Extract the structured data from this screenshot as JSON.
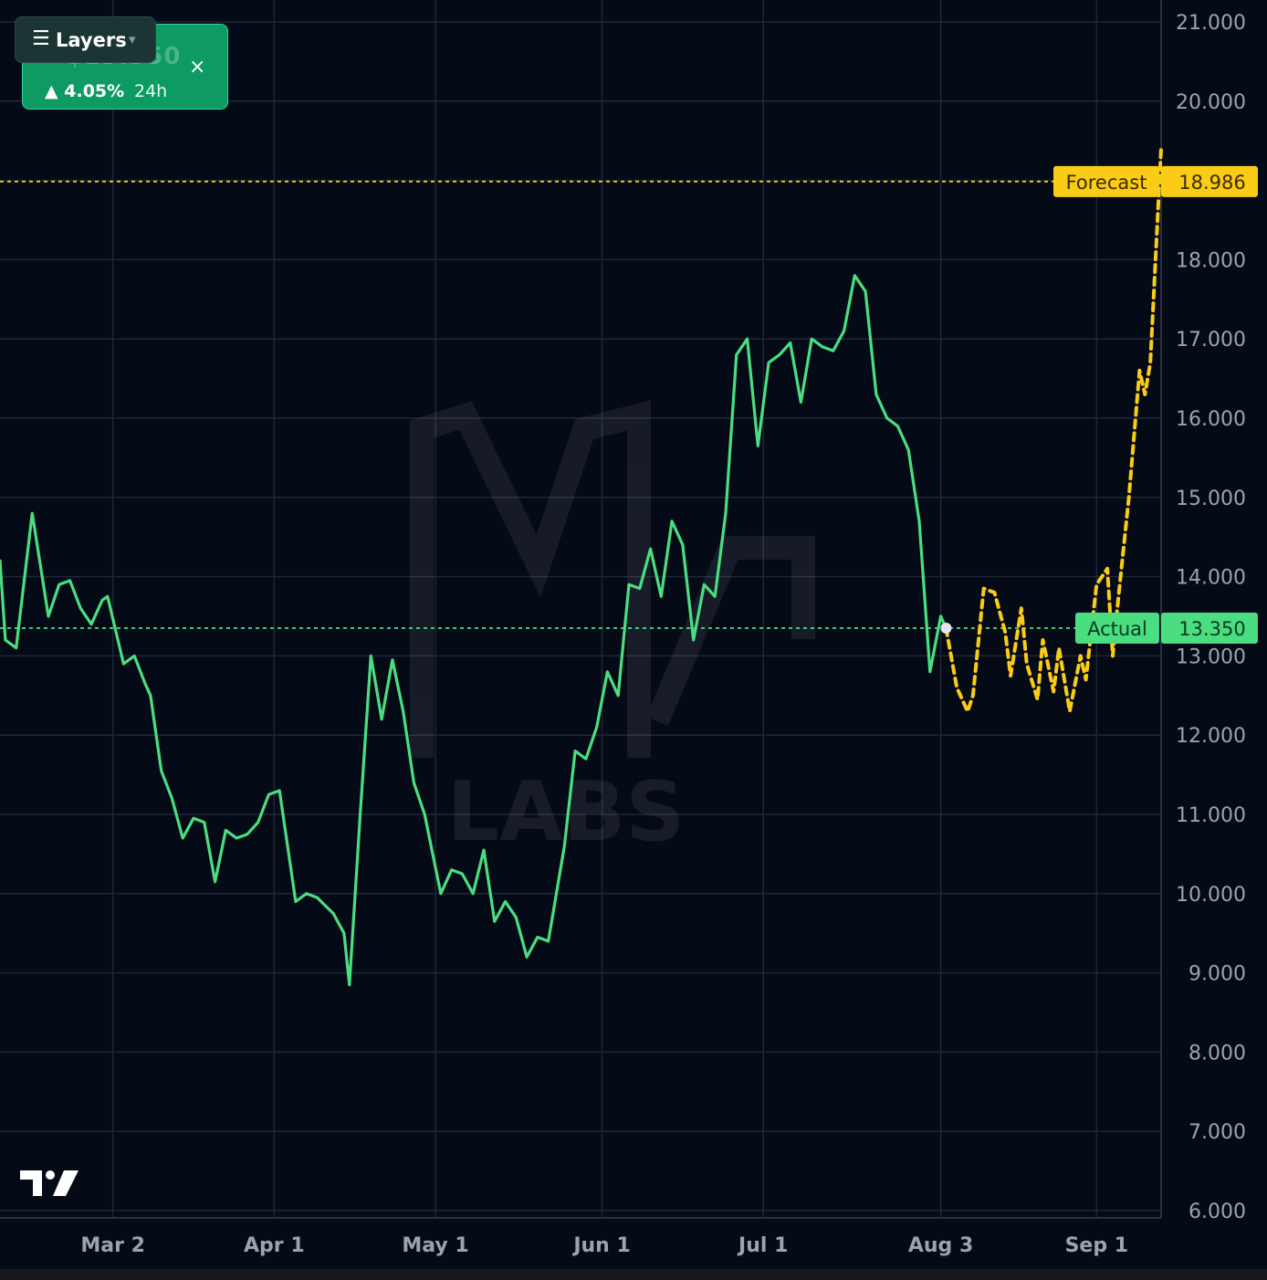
{
  "price_card": {
    "price": "$13.350",
    "change_arrow": "▲",
    "change": "4.05%",
    "period": "24h",
    "close_icon": "×"
  },
  "layers": {
    "menu_icon": "☰",
    "label": "Layers",
    "caret": "▾"
  },
  "watermark": "LABS",
  "colors": {
    "background": "#050a17",
    "grid": "#1f2637",
    "actual": "#4ade80",
    "forecast": "#facc15",
    "axis_text": "#9ca3af"
  },
  "chart_data": {
    "type": "line",
    "ylim": [
      6,
      21
    ],
    "y_ticks": [
      "6.000",
      "7.000",
      "8.000",
      "9.000",
      "10.000",
      "11.000",
      "12.000",
      "13.000",
      "14.000",
      "15.000",
      "16.000",
      "17.000",
      "18.000",
      "19.000",
      "20.000",
      "21.000"
    ],
    "x_range": [
      "2025-02-09",
      "2025-09-13"
    ],
    "x_ticks": [
      {
        "date": "2025-03-02",
        "label": "Mar 2"
      },
      {
        "date": "2025-04-01",
        "label": "Apr 1"
      },
      {
        "date": "2025-05-01",
        "label": "May 1"
      },
      {
        "date": "2025-06-01",
        "label": "Jun 1"
      },
      {
        "date": "2025-07-01",
        "label": "Jul 1"
      },
      {
        "date": "2025-08-03",
        "label": "Aug 3"
      },
      {
        "date": "2025-09-01",
        "label": "Sep 1"
      }
    ],
    "grid": true,
    "series": [
      {
        "name": "Actual",
        "style": "solid",
        "points": [
          [
            "2025-02-09",
            14.2
          ],
          [
            "2025-02-10",
            13.2
          ],
          [
            "2025-02-12",
            13.1
          ],
          [
            "2025-02-15",
            14.8
          ],
          [
            "2025-02-18",
            13.5
          ],
          [
            "2025-02-20",
            13.9
          ],
          [
            "2025-02-22",
            13.95
          ],
          [
            "2025-02-24",
            13.6
          ],
          [
            "2025-02-26",
            13.4
          ],
          [
            "2025-02-28",
            13.7
          ],
          [
            "2025-03-01",
            13.75
          ],
          [
            "2025-03-04",
            12.9
          ],
          [
            "2025-03-06",
            13.0
          ],
          [
            "2025-03-08",
            12.65
          ],
          [
            "2025-03-09",
            12.5
          ],
          [
            "2025-03-11",
            11.55
          ],
          [
            "2025-03-13",
            11.2
          ],
          [
            "2025-03-15",
            10.7
          ],
          [
            "2025-03-17",
            10.95
          ],
          [
            "2025-03-19",
            10.9
          ],
          [
            "2025-03-21",
            10.15
          ],
          [
            "2025-03-23",
            10.8
          ],
          [
            "2025-03-25",
            10.7
          ],
          [
            "2025-03-27",
            10.75
          ],
          [
            "2025-03-29",
            10.9
          ],
          [
            "2025-03-31",
            11.25
          ],
          [
            "2025-04-02",
            11.3
          ],
          [
            "2025-04-05",
            9.9
          ],
          [
            "2025-04-07",
            10.0
          ],
          [
            "2025-04-09",
            9.95
          ],
          [
            "2025-04-12",
            9.75
          ],
          [
            "2025-04-14",
            9.5
          ],
          [
            "2025-04-15",
            8.85
          ],
          [
            "2025-04-17",
            11.0
          ],
          [
            "2025-04-19",
            13.0
          ],
          [
            "2025-04-21",
            12.2
          ],
          [
            "2025-04-23",
            12.95
          ],
          [
            "2025-04-25",
            12.3
          ],
          [
            "2025-04-27",
            11.4
          ],
          [
            "2025-04-29",
            11.0
          ],
          [
            "2025-05-02",
            10.0
          ],
          [
            "2025-05-04",
            10.3
          ],
          [
            "2025-05-06",
            10.25
          ],
          [
            "2025-05-08",
            10.0
          ],
          [
            "2025-05-10",
            10.55
          ],
          [
            "2025-05-12",
            9.65
          ],
          [
            "2025-05-14",
            9.9
          ],
          [
            "2025-05-16",
            9.7
          ],
          [
            "2025-05-18",
            9.2
          ],
          [
            "2025-05-20",
            9.45
          ],
          [
            "2025-05-22",
            9.4
          ],
          [
            "2025-05-25",
            10.6
          ],
          [
            "2025-05-27",
            11.8
          ],
          [
            "2025-05-29",
            11.7
          ],
          [
            "2025-05-31",
            12.1
          ],
          [
            "2025-06-02",
            12.8
          ],
          [
            "2025-06-04",
            12.5
          ],
          [
            "2025-06-06",
            13.9
          ],
          [
            "2025-06-08",
            13.85
          ],
          [
            "2025-06-10",
            14.35
          ],
          [
            "2025-06-12",
            13.75
          ],
          [
            "2025-06-14",
            14.7
          ],
          [
            "2025-06-16",
            14.4
          ],
          [
            "2025-06-18",
            13.2
          ],
          [
            "2025-06-20",
            13.9
          ],
          [
            "2025-06-22",
            13.75
          ],
          [
            "2025-06-24",
            14.8
          ],
          [
            "2025-06-26",
            16.8
          ],
          [
            "2025-06-28",
            17.0
          ],
          [
            "2025-06-30",
            15.65
          ],
          [
            "2025-07-02",
            16.7
          ],
          [
            "2025-07-04",
            16.8
          ],
          [
            "2025-07-06",
            16.95
          ],
          [
            "2025-07-08",
            16.2
          ],
          [
            "2025-07-10",
            17.0
          ],
          [
            "2025-07-12",
            16.9
          ],
          [
            "2025-07-14",
            16.85
          ],
          [
            "2025-07-16",
            17.1
          ],
          [
            "2025-07-18",
            17.8
          ],
          [
            "2025-07-20",
            17.6
          ],
          [
            "2025-07-22",
            16.3
          ],
          [
            "2025-07-24",
            16.0
          ],
          [
            "2025-07-26",
            15.9
          ],
          [
            "2025-07-28",
            15.6
          ],
          [
            "2025-07-30",
            14.7
          ],
          [
            "2025-08-01",
            12.8
          ],
          [
            "2025-08-03",
            13.5
          ],
          [
            "2025-08-04",
            13.35
          ]
        ]
      },
      {
        "name": "Forecast",
        "style": "dashed",
        "points": [
          [
            "2025-08-04",
            13.35
          ],
          [
            "2025-08-06",
            12.6
          ],
          [
            "2025-08-08",
            12.3
          ],
          [
            "2025-08-09",
            12.5
          ],
          [
            "2025-08-11",
            13.85
          ],
          [
            "2025-08-13",
            13.8
          ],
          [
            "2025-08-15",
            13.3
          ],
          [
            "2025-08-16",
            12.75
          ],
          [
            "2025-08-18",
            13.6
          ],
          [
            "2025-08-19",
            12.9
          ],
          [
            "2025-08-21",
            12.45
          ],
          [
            "2025-08-22",
            13.2
          ],
          [
            "2025-08-24",
            12.55
          ],
          [
            "2025-08-25",
            13.1
          ],
          [
            "2025-08-27",
            12.3
          ],
          [
            "2025-08-29",
            13.0
          ],
          [
            "2025-08-30",
            12.7
          ],
          [
            "2025-09-01",
            13.9
          ],
          [
            "2025-09-03",
            14.1
          ],
          [
            "2025-09-04",
            13.0
          ],
          [
            "2025-09-05",
            13.7
          ],
          [
            "2025-09-07",
            15.0
          ],
          [
            "2025-09-09",
            16.6
          ],
          [
            "2025-09-10",
            16.3
          ],
          [
            "2025-09-11",
            16.7
          ],
          [
            "2025-09-13",
            19.4
          ]
        ]
      }
    ],
    "markers": [
      {
        "label": "Forecast",
        "value": "18.986",
        "y": 18.986,
        "color": "#facc15"
      },
      {
        "label": "Actual",
        "value": "13.350",
        "y": 13.35,
        "color": "#4ade80"
      }
    ]
  }
}
